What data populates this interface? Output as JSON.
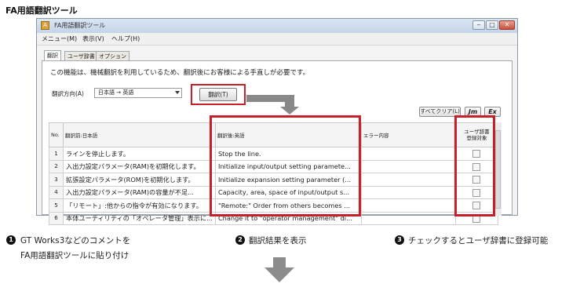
{
  "page_title": "FA用語翻訳ツール",
  "window": {
    "title": "FA用語翻訳ツール",
    "controls": {
      "minimize": "‒",
      "maximize": "□",
      "close": "✕"
    },
    "menu": [
      "メニュー(M)",
      "表示(V)",
      "ヘルプ(H)"
    ],
    "tabs": [
      "翻訳",
      "ユーザ辞書",
      "オプション"
    ],
    "notice": "この機能は、機械翻訳を利用しているため、翻訳後にお客様による手直しが必要です。",
    "direction_label": "翻訳方向(A)",
    "direction_value": "日本語 → 英語",
    "translate_button": "翻訳(T)",
    "clear_all_button": "すべてクリア(L)",
    "jm_button": "Jm",
    "ex_button": "Ex",
    "grid": {
      "headers": [
        "No.",
        "翻訳前:日本語",
        "翻訳後:英語",
        "エラー内容",
        "ユーザ辞書\n登録対象"
      ],
      "rows": [
        {
          "no": "1",
          "source": "ラインを停止します。",
          "target": "Stop the line.",
          "error": ""
        },
        {
          "no": "2",
          "source": "入出力設定パラメータ(RAM)を初期化します。",
          "target": "Initialize input/output setting paramete...",
          "error": ""
        },
        {
          "no": "3",
          "source": "拡張設定パラメータ(ROM)を初期化します。",
          "target": "Initialize expansion setting parameter (...",
          "error": ""
        },
        {
          "no": "4",
          "source": "入出力設定パラメータ(RAM)の容量が不足...",
          "target": "Capacity, area, space of input/output s...",
          "error": ""
        },
        {
          "no": "5",
          "source": "「リモート」:他からの指令が有効になります。",
          "target": "\"Remote:\" Order from others becomes ...",
          "error": ""
        },
        {
          "no": "6",
          "source": "本体ユーティリティの「オペレータ管理」表示に...",
          "target": "Change it to \"operator management\" di...",
          "error": ""
        }
      ]
    }
  },
  "captions": [
    {
      "number": "1",
      "lines": [
        "GT Works3などのコメントを",
        "FA用語翻訳ツールに貼り付け"
      ]
    },
    {
      "number": "2",
      "lines": [
        "翻訳結果を表示"
      ]
    },
    {
      "number": "3",
      "lines": [
        "チェックするとユーザ辞書に登録可能"
      ]
    }
  ],
  "colors": {
    "highlight": "#c8202b",
    "arrow": "#888888"
  }
}
